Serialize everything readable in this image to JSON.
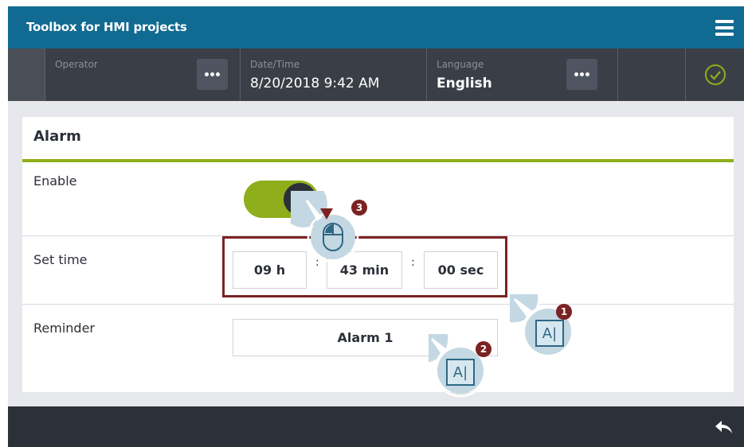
{
  "app": {
    "title": "Toolbox for HMI projects"
  },
  "header": {
    "operator": {
      "label": "Operator",
      "value": ""
    },
    "datetime": {
      "label": "Date/Time",
      "value": "8/20/2018 9:42 AM"
    },
    "language": {
      "label": "Language",
      "value": "English"
    }
  },
  "panel": {
    "title": "Alarm",
    "rows": {
      "enable": {
        "label": "Enable",
        "state": "on"
      },
      "set_time": {
        "label": "Set time",
        "hours": "09 h",
        "minutes": "43 min",
        "seconds": "00 sec",
        "separator": ":"
      },
      "reminder": {
        "label": "Reminder",
        "value": "Alarm 1"
      }
    }
  },
  "callouts": {
    "one": "1",
    "two": "2",
    "three": "3"
  },
  "colors": {
    "titlebar": "#116a91",
    "accent_green": "#8fae1b",
    "header": "#3a3f47",
    "footer": "#2c3038",
    "highlight": "#7b2222",
    "callout_fill": "#c3d8e2"
  },
  "icons": [
    "menu-icon",
    "more-dots-icon",
    "check-circle-icon",
    "text-cursor-icon",
    "mouse-icon",
    "back-arrow-icon"
  ]
}
